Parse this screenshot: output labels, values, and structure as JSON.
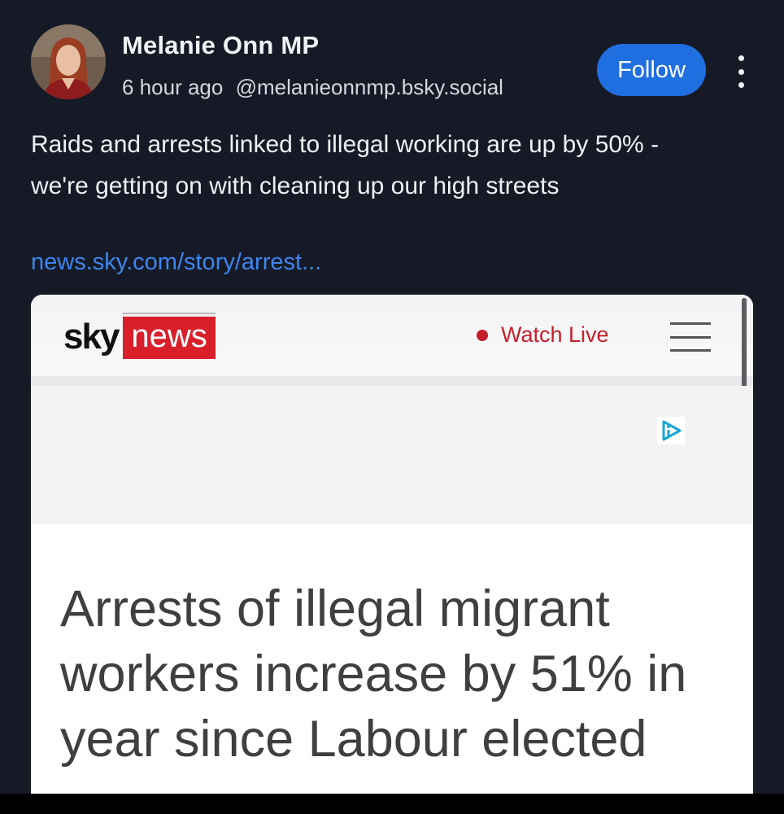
{
  "post": {
    "author_name": "Melanie Onn MP",
    "time_ago": "6 hour ago",
    "handle": "@melanieonnmp.bsky.social",
    "follow_label": "Follow",
    "text_line_1": "Raids and arrests linked to illegal working are up by 50% -",
    "text_line_2": "we're getting on with cleaning up our high streets",
    "link_text": "news.sky.com/story/arrest..."
  },
  "card": {
    "logo_sky": "sky",
    "logo_news": "news",
    "watch_live_label": "Watch Live",
    "headline_line_1": "Arrests of illegal migrant",
    "headline_line_2": "workers increase by 51% in",
    "headline_line_3": "year since Labour elected"
  },
  "icons": {
    "more": "more-vertical-icon",
    "menu": "hamburger-menu-icon",
    "ad": "ad-choices-icon",
    "live": "live-dot-icon"
  },
  "colors": {
    "background": "#161a26",
    "follow_button": "#1f6fe0",
    "link": "#3d86f0",
    "sky_red": "#d91f2a",
    "watch_live": "#c4202a"
  }
}
